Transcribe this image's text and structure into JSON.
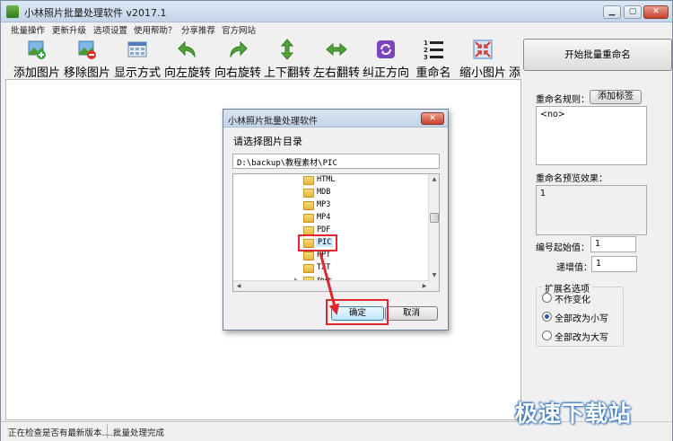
{
  "window": {
    "title": "小林照片批量处理软件 v2017.1",
    "min_label": "▁",
    "max_label": "▢",
    "close_label": "✕"
  },
  "menu": [
    "批量操作",
    "更新升级",
    "选项设置",
    "使用帮助？",
    "分享推荐",
    "官方网站"
  ],
  "toolbar": [
    {
      "label": "添加图片",
      "icon": "add-image-icon"
    },
    {
      "label": "移除图片",
      "icon": "remove-image-icon"
    },
    {
      "label": "显示方式",
      "icon": "view-mode-icon"
    },
    {
      "label": "向左旋转",
      "icon": "rotate-left-icon"
    },
    {
      "label": "向右旋转",
      "icon": "rotate-right-icon"
    },
    {
      "label": "上下翻转",
      "icon": "flip-vertical-icon"
    },
    {
      "label": "左右翻转",
      "icon": "flip-horizontal-icon"
    },
    {
      "label": "纠正方向",
      "icon": "correct-orientation-icon"
    },
    {
      "label": "重命名",
      "icon": "rename-icon"
    },
    {
      "label": "缩小图片",
      "icon": "shrink-image-icon"
    },
    {
      "label": "添",
      "icon": ""
    }
  ],
  "right_panel": {
    "start_button": "开始批量重命名",
    "rule_label": "重命名规则：",
    "add_tag_button": "添加标签",
    "rule_value": "<no>",
    "preview_label": "重命名预览效果：",
    "preview_value": "1",
    "start_no_label": "编号起始值：",
    "start_no_value": "1",
    "increment_label": "递增值：",
    "increment_value": "1",
    "ext_group_label": "扩展名选项",
    "ext_options": [
      {
        "label": "不作变化",
        "checked": false
      },
      {
        "label": "全部改为小写",
        "checked": true
      },
      {
        "label": "全部改为大写",
        "checked": false
      }
    ]
  },
  "dialog": {
    "title": "小林照片批量处理软件",
    "close_label": "✕",
    "prompt": "请选择图片目录",
    "path": "D:\\backup\\教程素材\\PIC",
    "folders": [
      {
        "name": "HTML",
        "expandable": false
      },
      {
        "name": "MDB",
        "expandable": false
      },
      {
        "name": "MP3",
        "expandable": false
      },
      {
        "name": "MP4",
        "expandable": false
      },
      {
        "name": "PDF",
        "expandable": false
      },
      {
        "name": "PIC",
        "expandable": false,
        "selected": true
      },
      {
        "name": "PPT",
        "expandable": false
      },
      {
        "name": "TXT",
        "expandable": false
      },
      {
        "name": "软件",
        "expandable": true
      }
    ],
    "ok_button": "确定",
    "cancel_button": "取消"
  },
  "status": {
    "left": "正在检查是否有最新版本......",
    "right": "批量处理完成"
  },
  "watermark": "极速下载站",
  "colors": {
    "highlight": "#e0262f",
    "selection": "#3399ff"
  }
}
